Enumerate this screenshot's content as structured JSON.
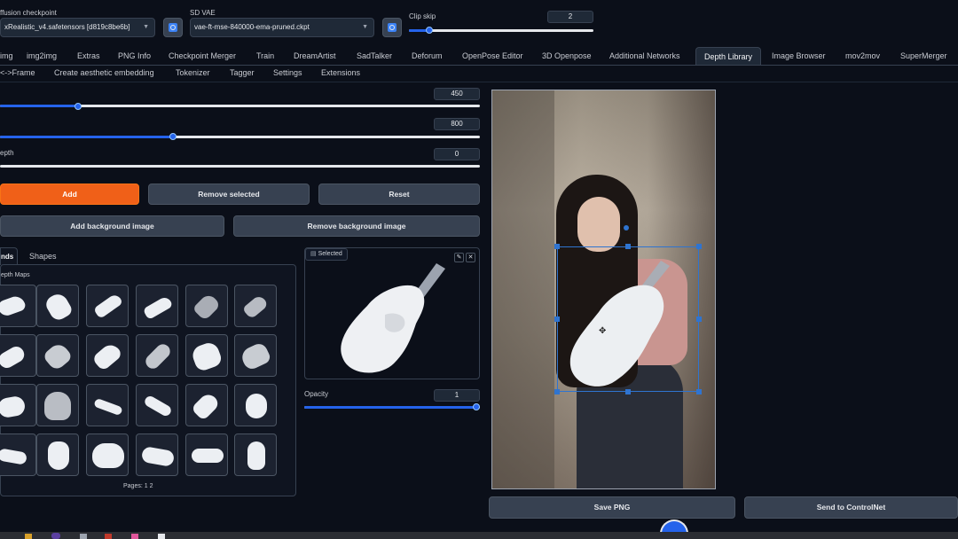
{
  "header": {
    "checkpoint_label": "ffusion checkpoint",
    "checkpoint_value": "xRealistic_v4.safetensors [d819c8be6b]",
    "vae_label": "SD VAE",
    "vae_value": "vae-ft-mse-840000-ema-pruned.ckpt",
    "clip_skip_label": "Clip skip",
    "clip_skip_value": "2",
    "clip_skip_level": 0.05
  },
  "tabs": [
    {
      "label": "img"
    },
    {
      "label": "img2img"
    },
    {
      "label": "Extras"
    },
    {
      "label": "PNG Info"
    },
    {
      "label": "Checkpoint Merger"
    },
    {
      "label": "Train"
    },
    {
      "label": "DreamArtist"
    },
    {
      "label": "SadTalker"
    },
    {
      "label": "Deforum"
    },
    {
      "label": "OpenPose Editor"
    },
    {
      "label": "3D Openpose"
    },
    {
      "label": "Additional Networks"
    },
    {
      "label": "Depth Library"
    },
    {
      "label": "Image Browser"
    },
    {
      "label": "mov2mov"
    },
    {
      "label": "SuperMerger"
    }
  ],
  "subtabs": [
    {
      "label": "<->Frame"
    },
    {
      "label": "Create aesthetic embedding"
    },
    {
      "label": "Tokenizer"
    },
    {
      "label": "Tagger"
    },
    {
      "label": "Settings"
    },
    {
      "label": "Extensions"
    }
  ],
  "sliders": {
    "width_value": "450",
    "height_value": "800",
    "depth_label": "epth",
    "depth_value": "0"
  },
  "buttons": {
    "add": "Add",
    "remove_selected": "Remove selected",
    "reset": "Reset",
    "add_background": "Add background image",
    "remove_background": "Remove background image",
    "save_png": "Save PNG",
    "send_to_controlnet": "Send to ControlNet"
  },
  "library": {
    "tab_hands": "nds",
    "tab_shapes": "Shapes",
    "section_label": "epth Maps",
    "pages_label": "Pages: 1 2"
  },
  "selected_panel": {
    "label": "Selected",
    "opacity_label": "Opacity",
    "opacity_value": "1"
  },
  "colors": {
    "accent_orange": "#f06018",
    "accent_blue": "#2563eb",
    "background": "#0b0f19"
  }
}
